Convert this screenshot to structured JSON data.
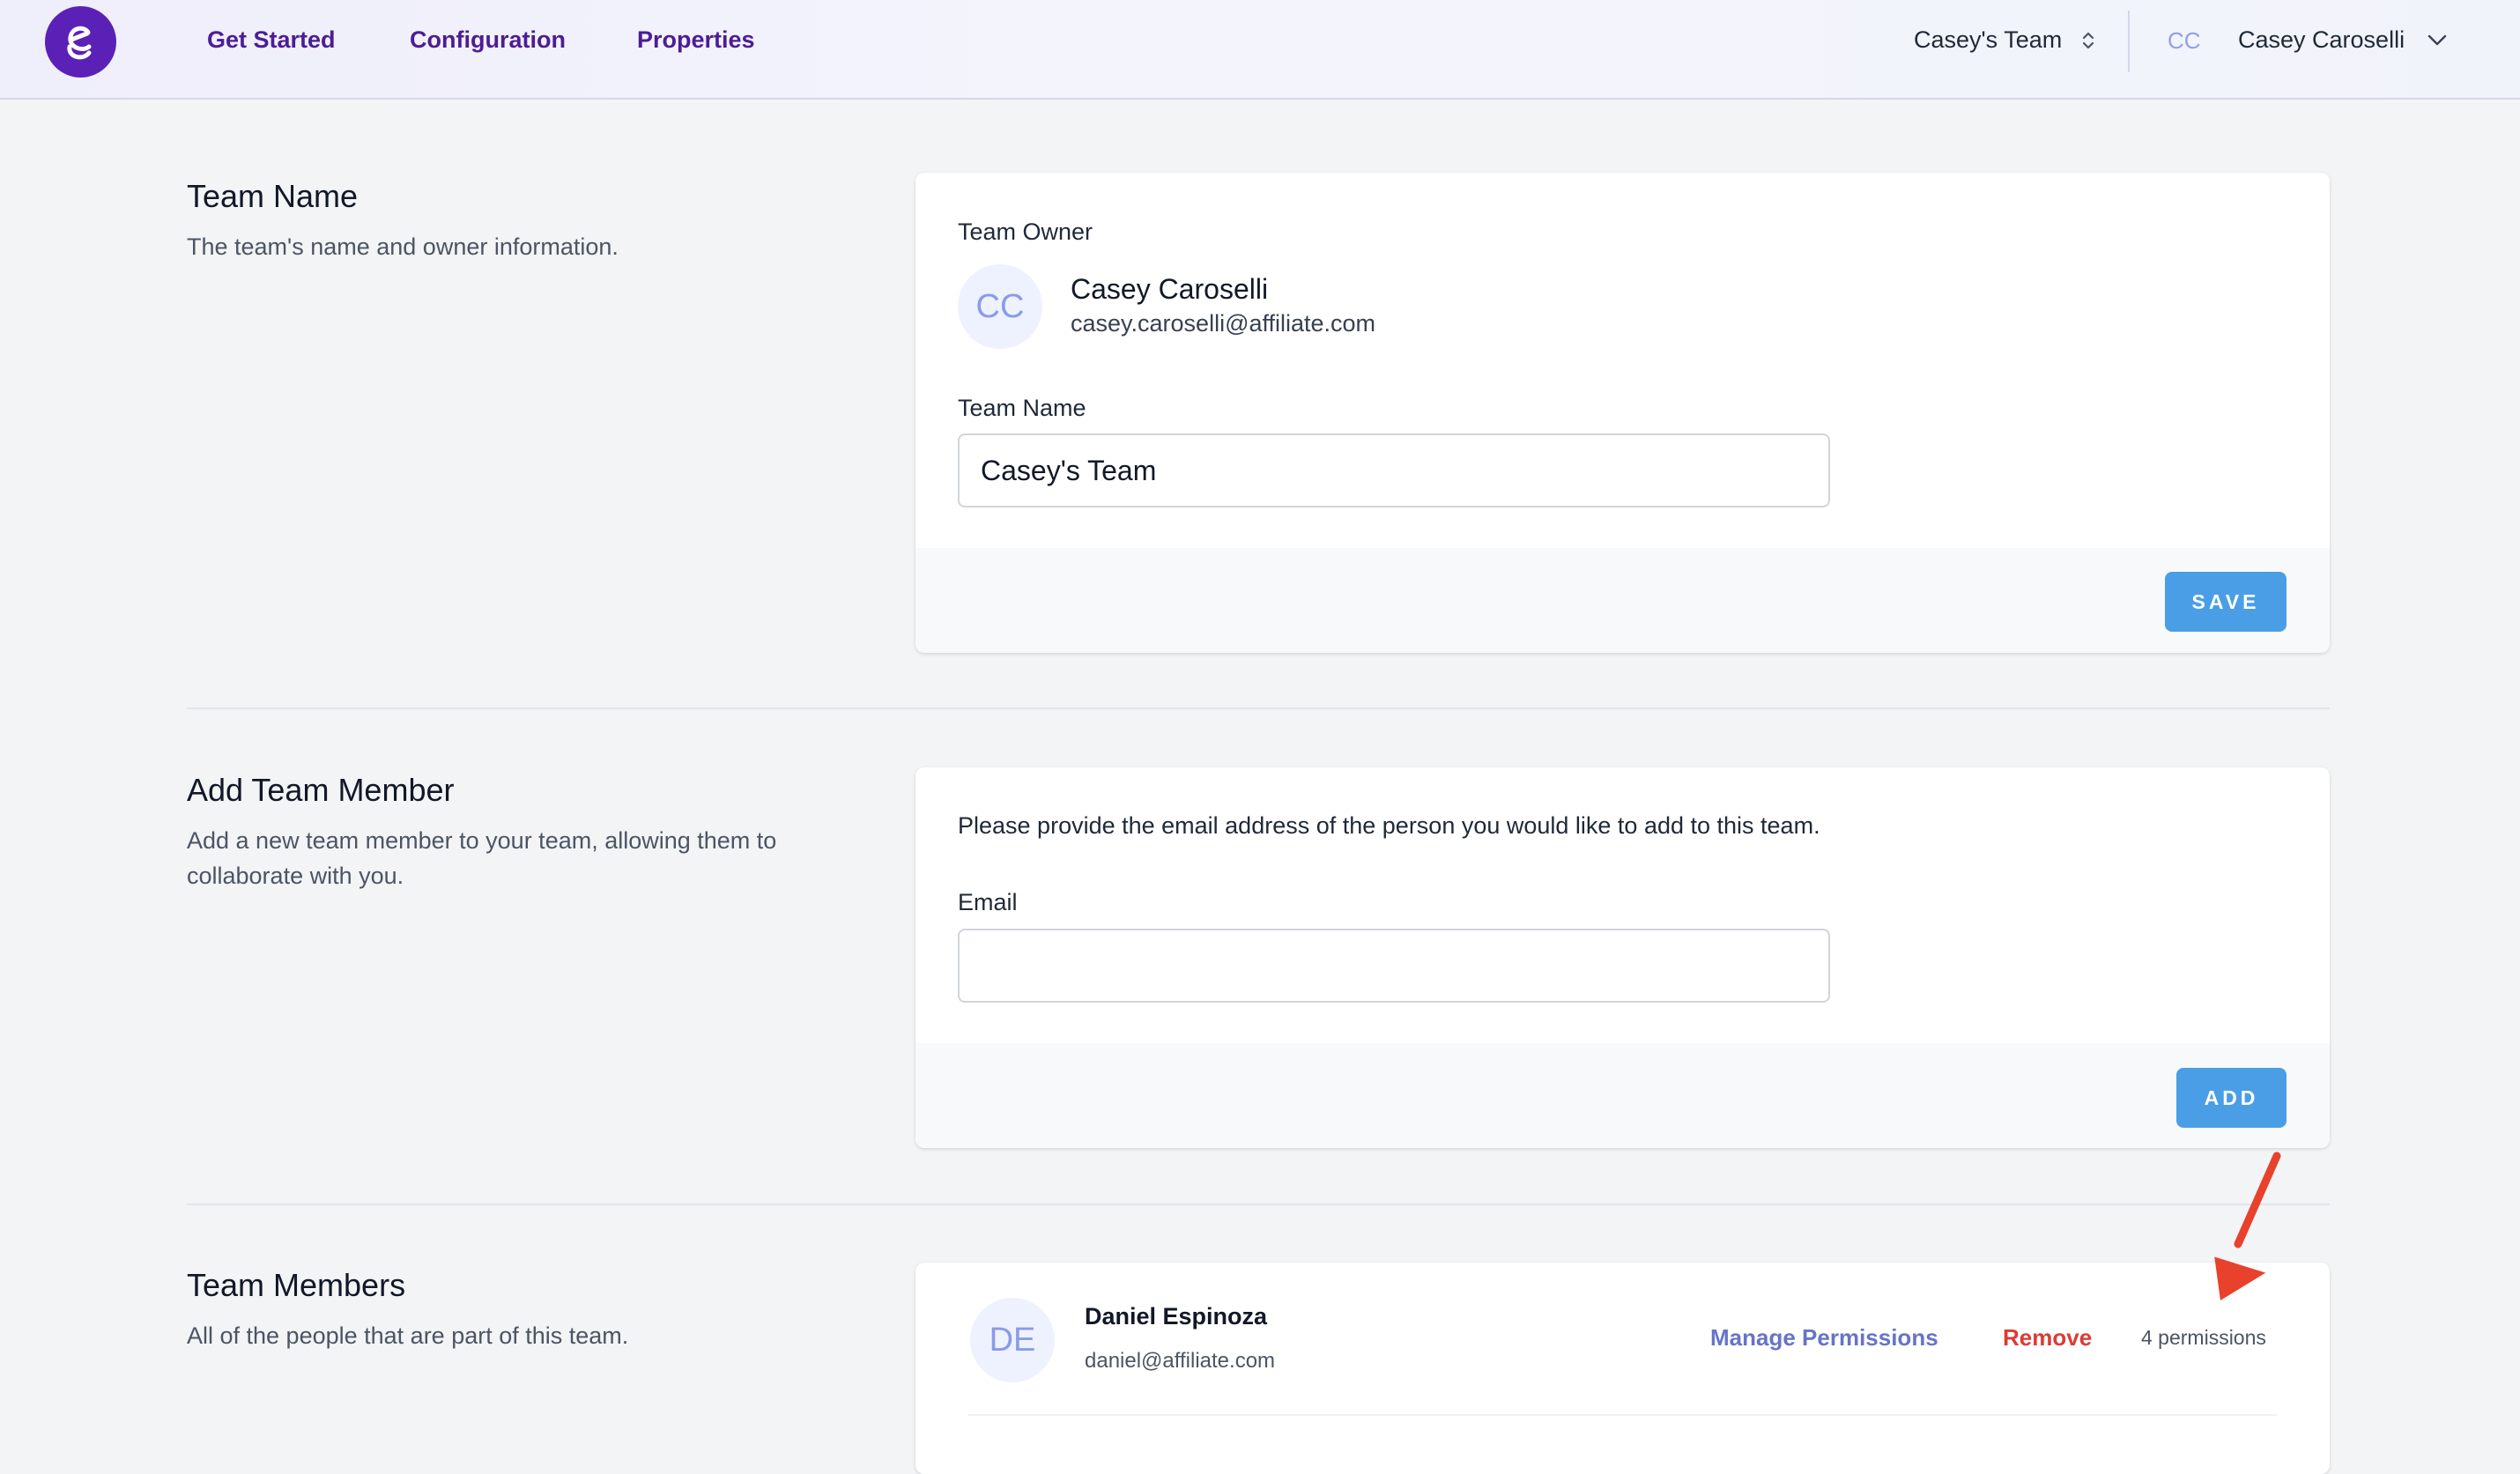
{
  "nav": {
    "links": [
      "Get Started",
      "Configuration",
      "Properties"
    ],
    "team_switcher": "Casey's Team",
    "user_initials": "CC",
    "user_name": "Casey Caroselli"
  },
  "team_name_section": {
    "title": "Team Name",
    "description": "The team's name and owner information.",
    "owner_label": "Team Owner",
    "owner_initials": "CC",
    "owner_name": "Casey Caroselli",
    "owner_email": "casey.caroselli@affiliate.com",
    "team_name_label": "Team Name",
    "team_name_value": "Casey's Team",
    "save_label": "SAVE"
  },
  "add_member_section": {
    "title": "Add Team Member",
    "description": "Add a new team member to your team, allowing them to collaborate with you.",
    "instructions": "Please provide the email address of the person you would like to add to this team.",
    "email_label": "Email",
    "email_value": "",
    "add_label": "ADD"
  },
  "members_section": {
    "title": "Team Members",
    "description": "All of the people that are part of this team.",
    "members": [
      {
        "initials": "DE",
        "name": "Daniel Espinoza",
        "email": "daniel@affiliate.com",
        "manage_label": "Manage Permissions",
        "remove_label": "Remove",
        "permissions": "4 permissions"
      }
    ]
  },
  "colors": {
    "brand": "#5b21b6",
    "nav_link": "#4c1d95",
    "primary_button": "#4a9ee6",
    "manage_link": "#6674c8",
    "remove_link": "#dc3b34",
    "annotation_arrow": "#e8412c"
  },
  "icons": [
    "logo-icon",
    "updown-chevron-icon",
    "chevron-down-icon",
    "annotation-arrow"
  ]
}
